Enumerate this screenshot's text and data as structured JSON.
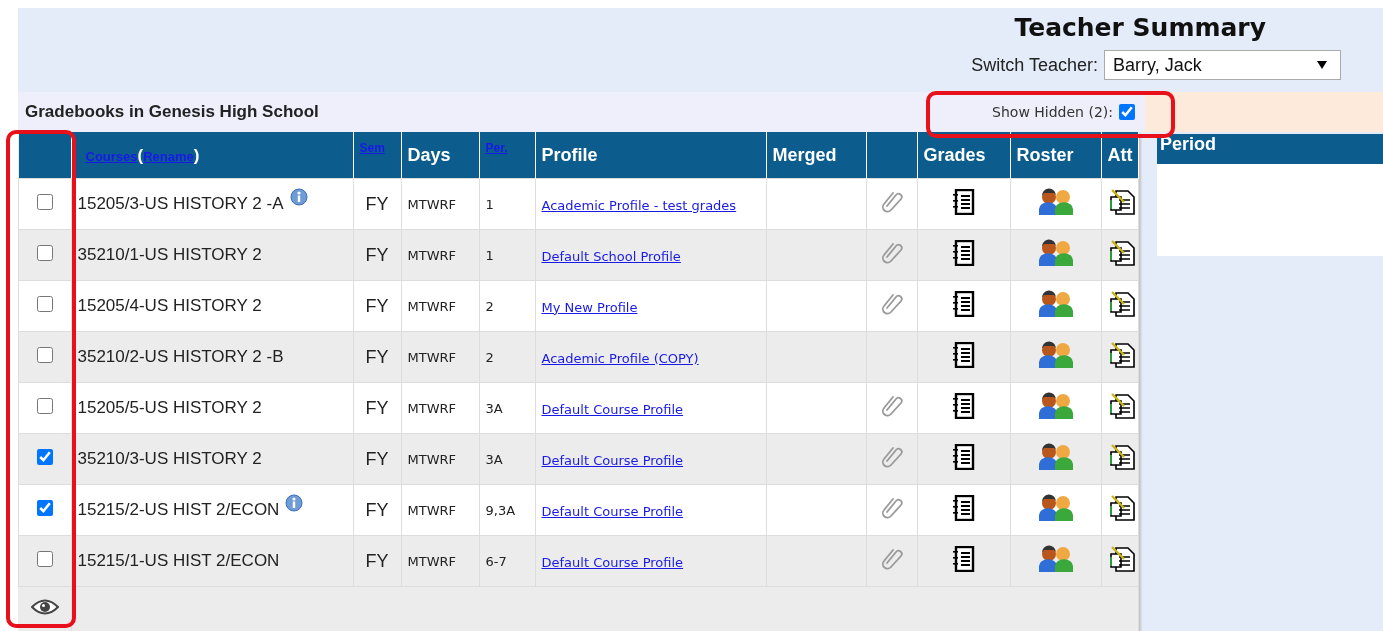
{
  "page": {
    "title": "Teacher Summary",
    "switch_teacher": {
      "label": "Switch Teacher:",
      "value": "Barry, Jack"
    }
  },
  "gradebooks": {
    "title": "Gradebooks in Genesis High School",
    "show_hidden": {
      "label": "Show Hidden (2):",
      "checked": true,
      "highlighted": true
    }
  },
  "table": {
    "select_column_highlighted": true,
    "columns": [
      {
        "kind": "select"
      },
      {
        "kind": "course",
        "label": "Courses",
        "open": "(",
        "rename": "Rename",
        "close": ")"
      },
      {
        "kind": "link",
        "label": "Sem"
      },
      {
        "kind": "text",
        "label": "Days"
      },
      {
        "kind": "link",
        "label": "Per."
      },
      {
        "kind": "text",
        "label": "Profile"
      },
      {
        "kind": "text",
        "label": "Merged"
      },
      {
        "kind": "blank"
      },
      {
        "kind": "text",
        "label": "Grades"
      },
      {
        "kind": "text",
        "label": "Roster"
      },
      {
        "kind": "text",
        "label": "Att"
      }
    ],
    "rows": [
      {
        "checked": false,
        "course": "15205/3-US HISTORY 2 -A",
        "info": true,
        "sem": "FY",
        "days": "MTWRF",
        "per": "1",
        "profile": "Academic Profile - test grades",
        "attachment": true
      },
      {
        "checked": false,
        "course": "35210/1-US HISTORY 2",
        "info": false,
        "sem": "FY",
        "days": "MTWRF",
        "per": "1",
        "profile": "Default School Profile",
        "attachment": true
      },
      {
        "checked": false,
        "course": "15205/4-US HISTORY 2",
        "info": false,
        "sem": "FY",
        "days": "MTWRF",
        "per": "2",
        "profile": "My New Profile",
        "attachment": true
      },
      {
        "checked": false,
        "course": "35210/2-US HISTORY 2 -B",
        "info": false,
        "sem": "FY",
        "days": "MTWRF",
        "per": "2",
        "profile": "Academic Profile (COPY)",
        "attachment": false
      },
      {
        "checked": false,
        "course": "15205/5-US HISTORY 2",
        "info": false,
        "sem": "FY",
        "days": "MTWRF",
        "per": "3A",
        "profile": "Default Course Profile",
        "attachment": true
      },
      {
        "checked": true,
        "course": "35210/3-US HISTORY 2",
        "info": false,
        "sem": "FY",
        "days": "MTWRF",
        "per": "3A",
        "profile": "Default Course Profile",
        "attachment": true
      },
      {
        "checked": true,
        "course": "15215/2-US HIST 2/ECON",
        "info": true,
        "sem": "FY",
        "days": "MTWRF",
        "per": "9,3A",
        "profile": "Default Course Profile",
        "attachment": true
      },
      {
        "checked": false,
        "course": "15215/1-US HIST 2/ECON",
        "info": false,
        "sem": "FY",
        "days": "MTWRF",
        "per": "6-7",
        "profile": "Default Course Profile",
        "attachment": true
      }
    ]
  },
  "period_panel": {
    "title": "Period"
  }
}
